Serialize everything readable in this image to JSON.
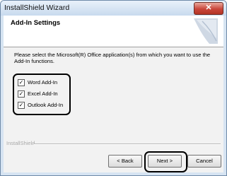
{
  "window": {
    "title": "InstallShield Wizard",
    "close_glyph": "✕"
  },
  "header": {
    "title": "Add-In Settings",
    "logo_icon": "wizard-graphic-icon"
  },
  "prompt": "Please select the Microsoft(R) Office application(s) from which you want to use the Add-In functions.",
  "options": [
    {
      "label": "Word Add-In",
      "checked": true,
      "glyph": "✓"
    },
    {
      "label": "Excel Add-In",
      "checked": true,
      "glyph": "✓"
    },
    {
      "label": "Outlook Add-In",
      "checked": true,
      "glyph": "✓"
    }
  ],
  "footer": {
    "brand": "InstallShield"
  },
  "buttons": {
    "back": "< Back",
    "next": "Next >",
    "cancel": "Cancel"
  }
}
